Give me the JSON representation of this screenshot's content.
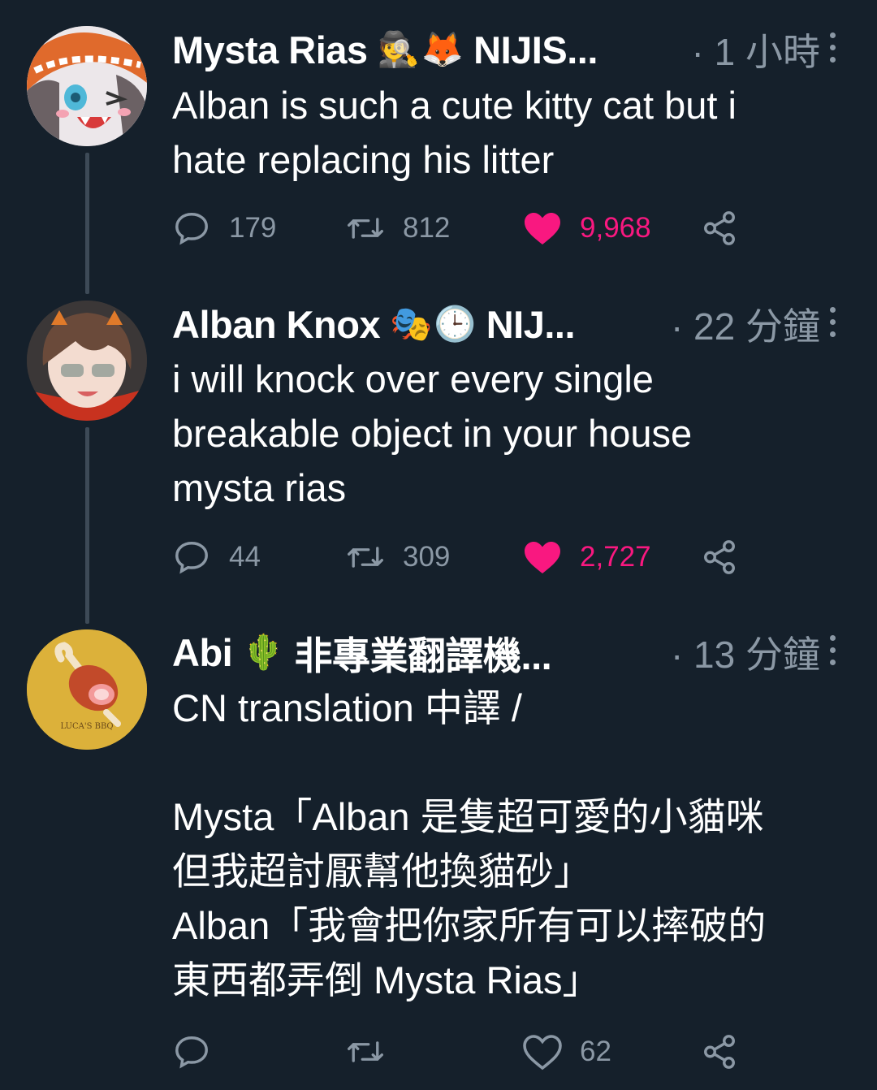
{
  "tweets": [
    {
      "name": "Mysta Rias",
      "emojis": [
        "🕵",
        "🦊"
      ],
      "handle": "NIJIS...",
      "time": "· 1 小時",
      "text": "Alban is such a cute kitty cat but i\nhate replacing his litter",
      "replies": "179",
      "retweets": "812",
      "likes": "9,968",
      "liked": true
    },
    {
      "name": "Alban Knox",
      "emojis": [
        "🎭",
        "🕒"
      ],
      "handle": "NIJ...",
      "time": "· 22 分鐘",
      "text": "i will knock over every single\nbreakable object in your house\nmysta rias",
      "replies": "44",
      "retweets": "309",
      "likes": "2,727",
      "liked": true
    },
    {
      "name": "Abi",
      "emojis": [
        "🌵"
      ],
      "handle": "非專業翻譯機...",
      "time": "· 13 分鐘",
      "text": "CN translation 中譯 /\n\nMysta「Alban 是隻超可愛的小貓咪\n但我超討厭幫他換貓砂」\nAlban「我會把你家所有可以摔破的\n東西都弄倒 Mysta Rias」",
      "avatar_text": "LUCA'S BBQ",
      "replies": "",
      "retweets": "",
      "likes": "62",
      "liked": false
    }
  ],
  "colors": {
    "background": "#15202b",
    "secondary_text": "#8b98a5",
    "like_pink": "#f91880",
    "thread_line": "#3d4a57"
  },
  "icons": [
    "reply-icon",
    "retweet-icon",
    "like-icon",
    "share-icon",
    "more-icon"
  ]
}
